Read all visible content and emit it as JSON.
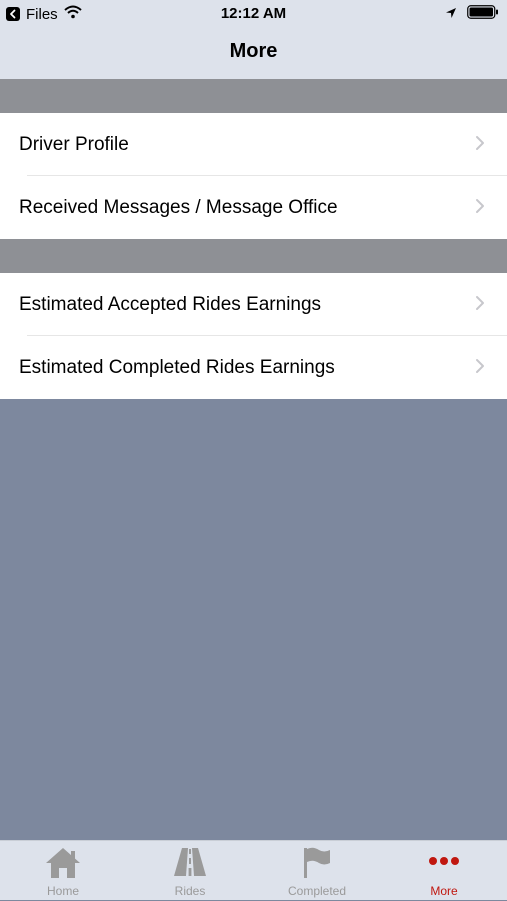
{
  "status_bar": {
    "back_app": "Files",
    "time": "12:12 AM"
  },
  "nav": {
    "title": "More"
  },
  "groups": [
    {
      "items": [
        {
          "label": "Driver Profile"
        },
        {
          "label": "Received Messages / Message Office"
        }
      ]
    },
    {
      "items": [
        {
          "label": "Estimated Accepted Rides Earnings"
        },
        {
          "label": "Estimated Completed Rides Earnings"
        }
      ]
    }
  ],
  "tabs": [
    {
      "label": "Home",
      "icon": "home-icon",
      "active": false
    },
    {
      "label": "Rides",
      "icon": "road-icon",
      "active": false
    },
    {
      "label": "Completed",
      "icon": "flag-icon",
      "active": false
    },
    {
      "label": "More",
      "icon": "more-dots-icon",
      "active": true
    }
  ],
  "colors": {
    "accent": "#c0170f",
    "inactive_tab": "#9a9a9a",
    "bar_background": "#dde2eb",
    "empty_background": "#7d889e",
    "separator": "#8e9095"
  }
}
